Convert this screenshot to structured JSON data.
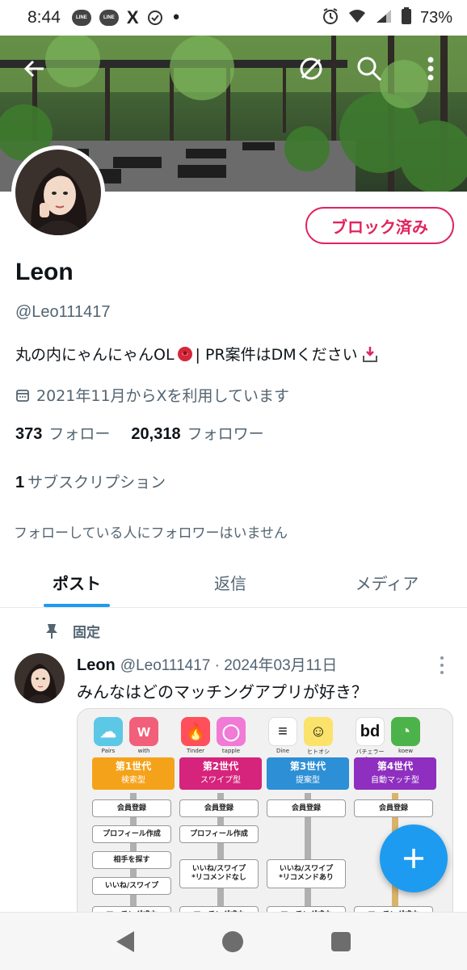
{
  "status_bar": {
    "time": "8:44",
    "notif_icons": [
      "line-icon",
      "line-icon",
      "x-icon",
      "check-circle-icon",
      "dot-icon"
    ],
    "line_label": "LINE",
    "x_label": "X",
    "battery": "73%"
  },
  "profile": {
    "name": "Leon",
    "handle": "@Leo111417",
    "block_label": "ブロック済み",
    "bio_prefix": "丸の内にゃんにゃんOL",
    "bio_suffix": " | PR案件はDMください",
    "joined": "2021年11月からXを利用しています",
    "following_count": "373",
    "following_label": "フォロー",
    "followers_count": "20,318",
    "followers_label": "フォロワー",
    "subscriptions_count": "1",
    "subscriptions_label": "サブスクリプション",
    "no_followers_known": "フォローしている人にフォロワーはいません"
  },
  "tabs": [
    {
      "label": "ポスト",
      "active": true
    },
    {
      "label": "返信",
      "active": false
    },
    {
      "label": "メディア",
      "active": false
    }
  ],
  "pinned_post": {
    "pinned_label": "固定",
    "author": "Leon",
    "meta": "@Leo111417 · 2024年03月11日",
    "text": "みんなはどのマッチングアプリが好き？",
    "image": {
      "apps": [
        {
          "label": "Pairs",
          "color": "#5cc8e6",
          "glyph": "☁"
        },
        {
          "label": "with",
          "color": "#f25f7a",
          "glyph": "w"
        },
        {
          "label": "Tinder",
          "color": "#fe4f5b",
          "glyph": "🔥"
        },
        {
          "label": "tapple",
          "color": "#f07ad5",
          "glyph": "◯"
        },
        {
          "label": "Dine",
          "color": "#ffffff",
          "glyph": "≡"
        },
        {
          "label": "ヒトオシ",
          "color": "#fbe26a",
          "glyph": "☺"
        },
        {
          "label": "バチェラーデート",
          "color": "#ffffff",
          "glyph": "bd"
        },
        {
          "label": "koew",
          "color": "#4cb34a",
          "glyph": "◔"
        }
      ],
      "generations": [
        {
          "title": "第1世代",
          "sub": "検索型",
          "color": "#f5a21b"
        },
        {
          "title": "第2世代",
          "sub": "スワイプ型",
          "color": "#d6247c"
        },
        {
          "title": "第3世代",
          "sub": "提案型",
          "color": "#2d8fd5"
        },
        {
          "title": "第4世代",
          "sub": "自動マッチ型",
          "color": "#8e2fc0"
        }
      ],
      "col1_steps": [
        "会員登録",
        "プロフィール作成",
        "相手を探す",
        "いいね/スワイプ",
        "マッチング成立"
      ],
      "col2_steps": [
        "会員登録",
        "プロフィール作成",
        "いいね/スワイプ\n*リコメンドなし",
        "マッチング成立"
      ],
      "col3_steps": [
        "会員登録",
        "いいね/スワイプ\n*リコメンドあり",
        "マッチング成立"
      ],
      "col4_steps": [
        "会員登録",
        "マッチング成立"
      ]
    }
  },
  "colors": {
    "accent": "#1d9bf0",
    "blocked": "#e0245e",
    "muted_text": "#536471"
  }
}
